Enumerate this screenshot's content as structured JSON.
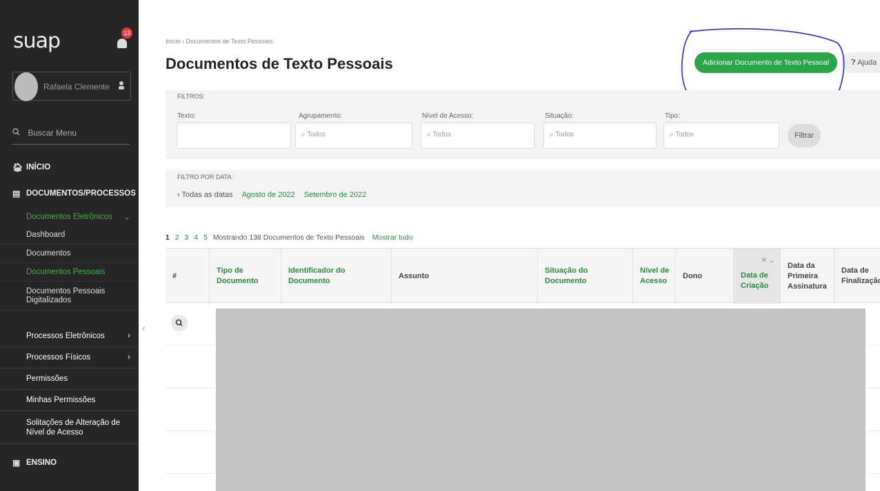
{
  "sidebar": {
    "logo": "suap",
    "notifications": "13",
    "user_name": "Rafaela Clemente",
    "search_label": "Buscar Menu",
    "nav_inicio": "INÍCIO",
    "nav_docs": "DOCUMENTOS/PROCESSOS",
    "docs_eletronicos": "Documentos Eletrônicos",
    "sub_items": [
      "Dashboard",
      "Documentos",
      "Documentos Pessoais",
      "Documentos Pessoais Digitalizados"
    ],
    "groups": [
      "Processos Eletrônicos",
      "Processos Físicos",
      "Permissões",
      "Minhas Permissões",
      "Solitações de Alteração de Nível de Acesso"
    ],
    "nav_ensino": "ENSINO"
  },
  "header": {
    "breadcrumb": "Início › Documentos de Texto Pessoais",
    "title": "Documentos de Texto Pessoais",
    "add_button": "Adicionar Documento de Texto Pessoal",
    "help_button": "Ajuda"
  },
  "filters": {
    "label": "FILTROS:",
    "fields": [
      {
        "label": "Texto:",
        "value": ""
      },
      {
        "label": "Agrupamento:",
        "value": "Todos"
      },
      {
        "label": "Nível de Acesso:",
        "value": "Todos"
      },
      {
        "label": "Situação:",
        "value": "Todos"
      },
      {
        "label": "Tipo:",
        "value": "Todos"
      }
    ],
    "button": "Filtrar"
  },
  "date_filter": {
    "label": "FILTRO POR DATA:",
    "all": "‹ Todas as datas",
    "options": [
      "Agosto de 2022",
      "Setembro de 2022"
    ]
  },
  "pagination": {
    "pages": [
      "1",
      "2",
      "3",
      "4",
      "5"
    ],
    "summary": "Mostrando 138 Documentos de Texto Pessoais",
    "show_all": "Mostrar tudo"
  },
  "table": {
    "columns": [
      "#",
      "Tipo de Documento",
      "Identificador do Documento",
      "Assunto",
      "Situação do Documento",
      "Nível de Acesso",
      "Dono",
      "Data de Criação",
      "Data da Primeira Assinatura",
      "Data de Finalização"
    ]
  }
}
